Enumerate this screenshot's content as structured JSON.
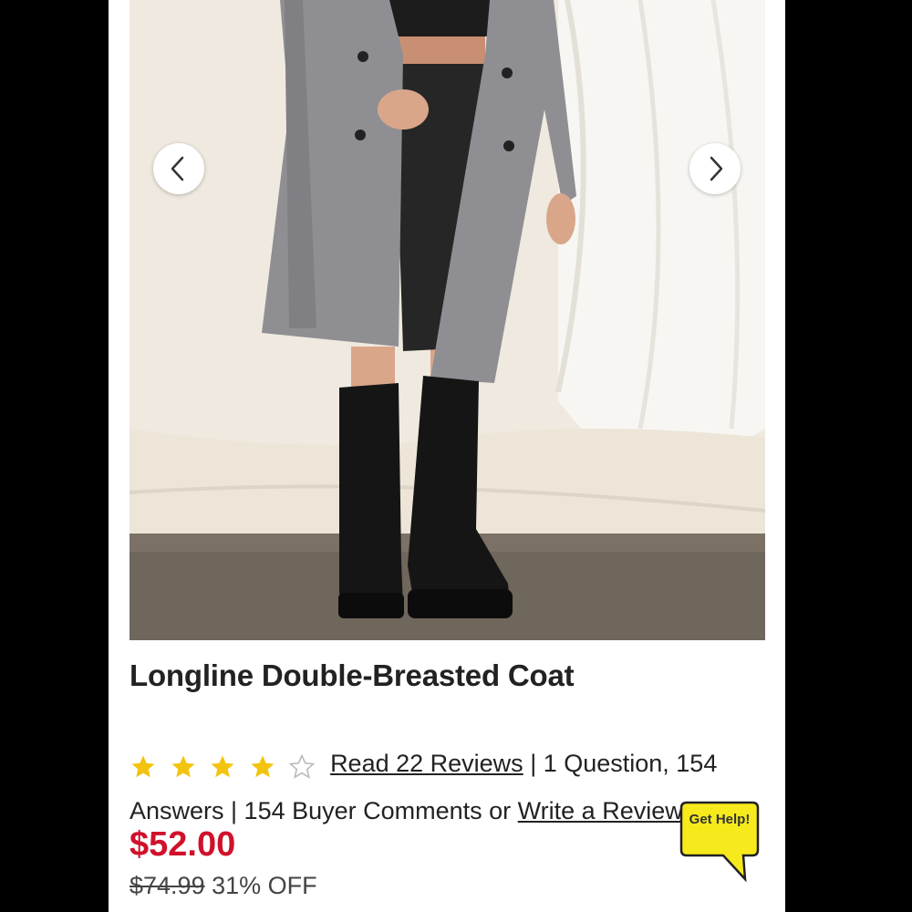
{
  "product": {
    "title": "Longline Double-Breasted Coat",
    "rating": 4,
    "max_rating": 5,
    "reviews_link": "Read 22 Reviews",
    "meta_part1": " | 1 Question, 154 Answers | 154 Buyer Comments or ",
    "write_review_link": "Write a Review",
    "price": "$52.00",
    "original_price": "$74.99",
    "discount": "31% OFF"
  },
  "help": {
    "label": "Get Help!"
  },
  "colors": {
    "price": "#d0112b",
    "star": "#f2c40f",
    "help_bg": "#f6ea1c"
  },
  "icons": {
    "prev": "chevron-left-icon",
    "next": "chevron-right-icon",
    "star": "star-icon",
    "help": "speech-bubble-icon"
  }
}
